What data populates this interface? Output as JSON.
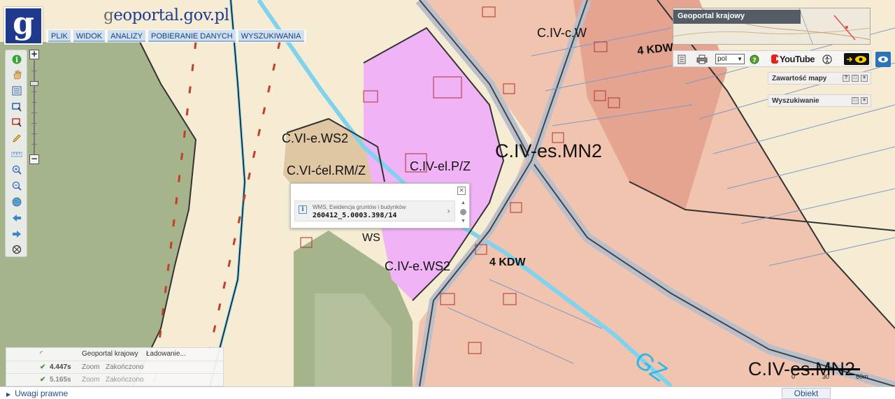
{
  "header": {
    "title_first": "g",
    "title_rest": "eoportal.gov.pl",
    "logo_letter": "g",
    "menu": [
      "PLIK",
      "WIDOK",
      "ANALIZY",
      "POBIERANIE DANYCH",
      "WYSZUKIWANIA"
    ]
  },
  "map_labels": [
    {
      "text": "C.IV-c.W"
    },
    {
      "text": "4 KDW"
    },
    {
      "text": "C.VI-e.WS2"
    },
    {
      "text": "C.VI-ćel.RM/Z"
    },
    {
      "text": "C.IV-el.P/Z"
    },
    {
      "text": "C.IV-es.MN2"
    },
    {
      "text": "C.IV-e.WS2"
    },
    {
      "text": "4 KDW"
    },
    {
      "text": "C.IV-es.MN2"
    },
    {
      "text": "GZ"
    },
    {
      "text": "WS"
    }
  ],
  "overview": {
    "title": "Geoportal krajowy"
  },
  "right_bar": {
    "language": "pol",
    "youtube": "YouTube"
  },
  "panels": {
    "map_content": "Zawartość mapy",
    "search": "Wyszukiwanie"
  },
  "popup": {
    "source": "WMS, Ewidencja gruntów i budynków",
    "parcel_id": "260412_5.0003.398/14"
  },
  "log": {
    "row1": {
      "service": "Geoportal krajowy",
      "status": "Ładowanie..."
    },
    "row2": {
      "time": "4.447s",
      "action": "Zoom",
      "status": "Zakończono"
    },
    "row3": {
      "time": "5.165s",
      "action": "Zoom",
      "status": "Zakończono"
    }
  },
  "scale": {
    "labels": [
      "0",
      "30",
      "60m"
    ]
  },
  "bottom": {
    "legal": "Uwagi prawne",
    "object": "Obiekt"
  },
  "colors": {
    "accent": "#1e3c93",
    "parcel_pink": "#eeb8a2",
    "industrial_violet": "#f0b4f6",
    "forest_green": "#a6b48c",
    "farmland": "#f6ecd4",
    "water": "#7fd3ef"
  }
}
